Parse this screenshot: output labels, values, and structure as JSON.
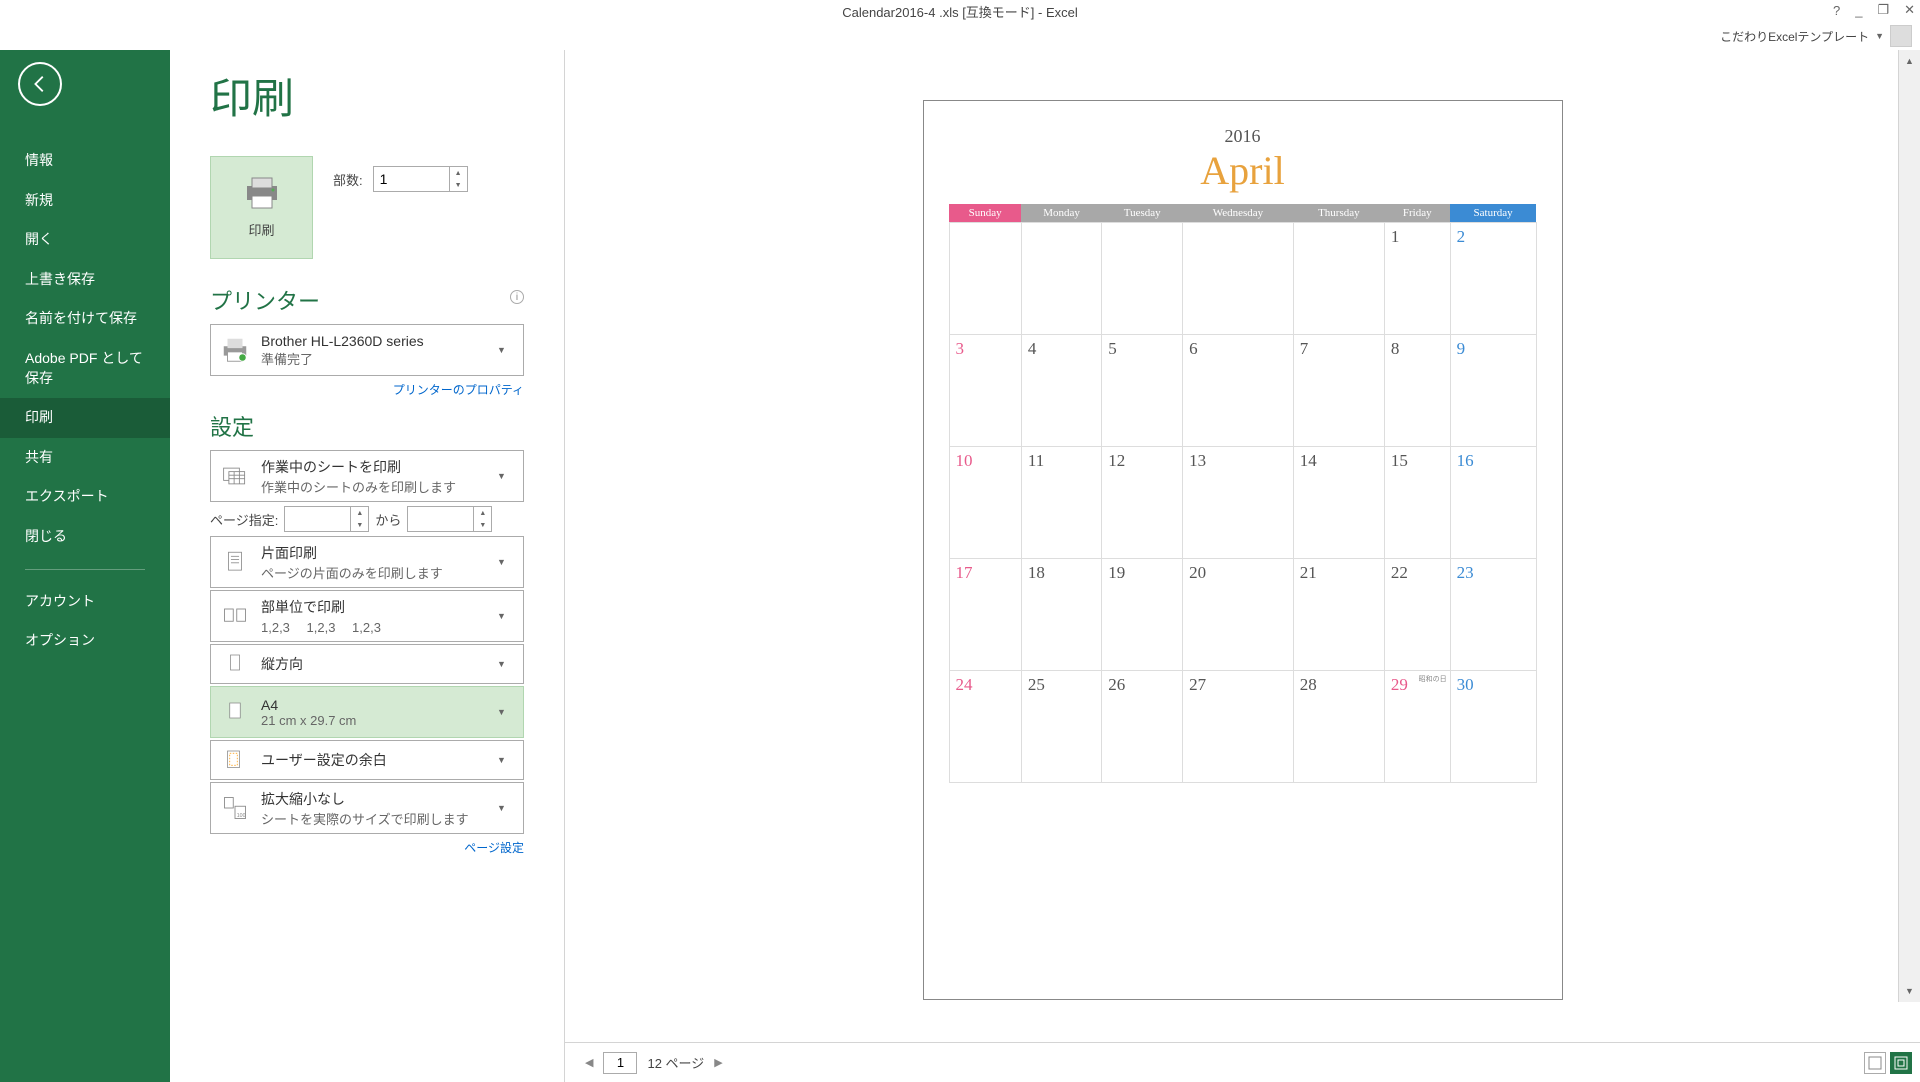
{
  "title": "Calendar2016-4 .xls  [互換モード] - Excel",
  "titlebar": {
    "help": "?",
    "minimize": "_",
    "restore": "❐",
    "close": "✕"
  },
  "ribbon_user": "こだわりExcelテンプレート",
  "sidebar": {
    "items": [
      "情報",
      "新規",
      "開く",
      "上書き保存",
      "名前を付けて保存",
      "Adobe PDF として保存",
      "印刷",
      "共有",
      "エクスポート",
      "閉じる"
    ],
    "items2": [
      "アカウント",
      "オプション"
    ],
    "selected_index": 6
  },
  "page": {
    "heading": "印刷",
    "print_button": "印刷",
    "copies_label": "部数:",
    "copies_value": "1",
    "printer_heading": "プリンター",
    "printer_name": "Brother HL-L2360D series",
    "printer_status": "準備完了",
    "printer_props": "プリンターのプロパティ",
    "settings_heading": "設定",
    "page_range_label": "ページ指定:",
    "page_range_from": "",
    "page_range_to_label": "から",
    "page_range_to": "",
    "page_setup": "ページ設定",
    "options": [
      {
        "title": "作業中のシートを印刷",
        "sub": "作業中のシートのみを印刷します"
      },
      {
        "title": "片面印刷",
        "sub": "ページの片面のみを印刷します"
      },
      {
        "title": "部単位で印刷",
        "sub": "1,2,3　 1,2,3　 1,2,3"
      },
      {
        "title": "縦方向",
        "sub": ""
      },
      {
        "title": "A4",
        "sub": "21 cm x 29.7 cm"
      },
      {
        "title": "ユーザー設定の余白",
        "sub": ""
      },
      {
        "title": "拡大縮小なし",
        "sub": "シートを実際のサイズで印刷します"
      }
    ]
  },
  "preview": {
    "current_page": "1",
    "page_total_label": "12 ページ",
    "calendar": {
      "year": "2016",
      "month": "April",
      "weekdays": [
        "Sunday",
        "Monday",
        "Tuesday",
        "Wednesday",
        "Thursday",
        "Friday",
        "Saturday"
      ],
      "rows": [
        [
          "",
          "",
          "",
          "",
          "",
          "1",
          "2"
        ],
        [
          "3",
          "4",
          "5",
          "6",
          "7",
          "8",
          "9"
        ],
        [
          "10",
          "11",
          "12",
          "13",
          "14",
          "15",
          "16"
        ],
        [
          "17",
          "18",
          "19",
          "20",
          "21",
          "22",
          "23"
        ],
        [
          "24",
          "25",
          "26",
          "27",
          "28",
          "29",
          "30"
        ]
      ],
      "holiday_cell": {
        "row": 4,
        "col": 5,
        "label": "昭和の日"
      }
    }
  }
}
